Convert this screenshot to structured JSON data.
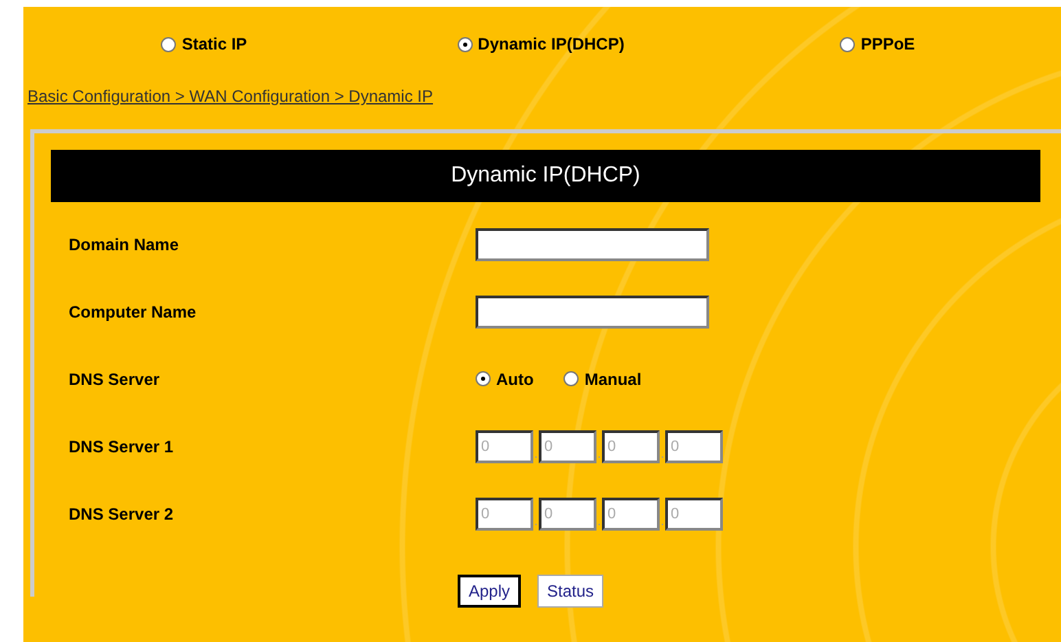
{
  "connection_types": [
    {
      "label": "Static IP",
      "selected": false
    },
    {
      "label": "Dynamic IP(DHCP)",
      "selected": true
    },
    {
      "label": "PPPoE",
      "selected": false
    }
  ],
  "breadcrumb": "Basic Configuration > WAN Configuration > Dynamic IP",
  "form": {
    "title": "Dynamic IP(DHCP)",
    "rows": [
      {
        "kind": "text",
        "label": "Domain Name",
        "value": ""
      },
      {
        "kind": "text",
        "label": "Computer Name",
        "value": ""
      },
      {
        "kind": "radio",
        "label": "DNS Server",
        "options": [
          {
            "label": "Auto",
            "selected": true
          },
          {
            "label": "Manual",
            "selected": false
          }
        ]
      },
      {
        "kind": "ip",
        "label": "DNS Server 1",
        "disabled": true,
        "octets": [
          "0",
          "0",
          "0",
          "0"
        ],
        "separators": [
          ".",
          ".",
          "."
        ]
      },
      {
        "kind": "ip",
        "label": "DNS Server 2",
        "disabled": true,
        "octets": [
          "0",
          "0",
          "0",
          "0"
        ],
        "separators": [
          ".",
          ".",
          "."
        ]
      }
    ],
    "buttons": [
      {
        "label": "Apply",
        "focused": true
      },
      {
        "label": "Status",
        "focused": false
      }
    ]
  }
}
